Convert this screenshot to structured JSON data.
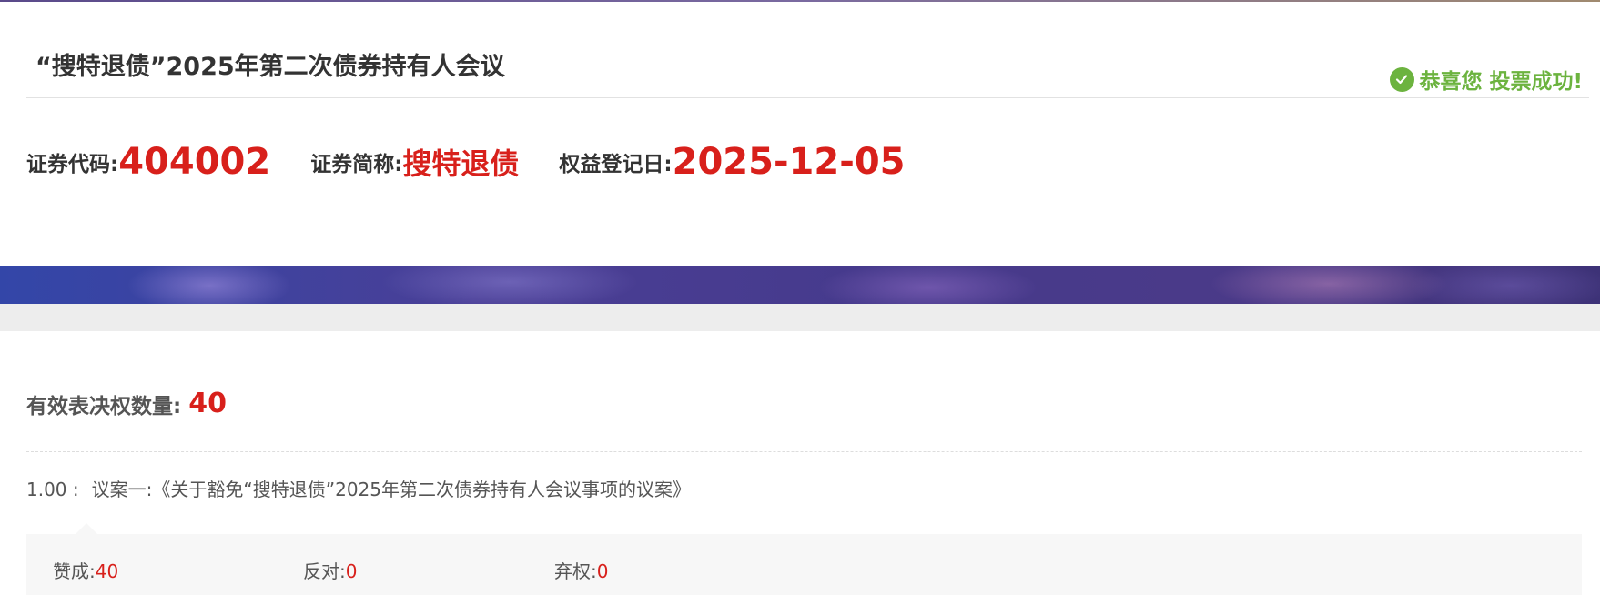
{
  "header": {
    "meeting_title": "“搜特退债”2025年第二次债券持有人会议",
    "success_message": "恭喜您 投票成功!"
  },
  "info": {
    "code_label": "证券代码:",
    "code_value": "404002",
    "name_label": "证券简称:",
    "name_value": "搜特退债",
    "date_label": "权益登记日:",
    "date_value": "2025-12-05"
  },
  "summary": {
    "votes_label": "有效表决权数量:",
    "votes_value": "40"
  },
  "proposal": {
    "number": "1.00 :",
    "title": "议案一:《关于豁免“搜特退债”2025年第二次债券持有人会议事项的议案》"
  },
  "votes": {
    "for_label": "赞成:",
    "for_value": "40",
    "against_label": "反对:",
    "against_value": "0",
    "abstain_label": "弃权:",
    "abstain_value": "0"
  },
  "icons": {
    "success": "check-circle-icon"
  },
  "colors": {
    "accent_red": "#d8201b",
    "success_green": "#6cb33f",
    "banner_purple": "#463a8c"
  }
}
